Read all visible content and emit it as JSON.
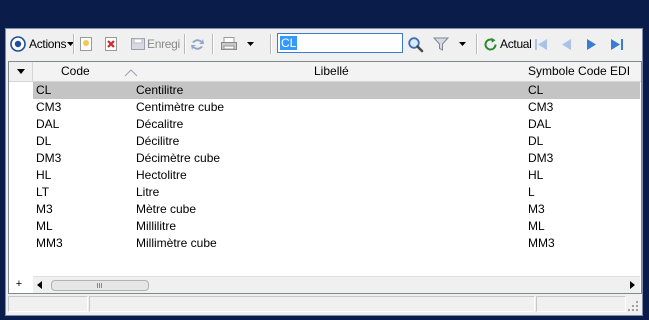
{
  "toolbar": {
    "actions_label": "Actions",
    "save_label": "Enregi",
    "search_value": "CL",
    "refresh_label": "Actual"
  },
  "grid": {
    "columns": [
      "Code",
      "Libellé",
      "Symbole Code EDI"
    ],
    "rows": [
      {
        "code": "CL",
        "libelle": "Centilitre",
        "edi": "CL"
      },
      {
        "code": "CM3",
        "libelle": "Centimètre cube",
        "edi": "CM3"
      },
      {
        "code": "DAL",
        "libelle": "Décalitre",
        "edi": "DAL"
      },
      {
        "code": "DL",
        "libelle": "Décilitre",
        "edi": "DL"
      },
      {
        "code": "DM3",
        "libelle": "Décimètre cube",
        "edi": "DM3"
      },
      {
        "code": "HL",
        "libelle": "Hectolitre",
        "edi": "HL"
      },
      {
        "code": "LT",
        "libelle": "Litre",
        "edi": "L"
      },
      {
        "code": "M3",
        "libelle": "Mètre cube",
        "edi": "M3"
      },
      {
        "code": "ML",
        "libelle": "Millilitre",
        "edi": "ML"
      },
      {
        "code": "MM3",
        "libelle": "Millimètre cube",
        "edi": "MM3"
      }
    ],
    "selected_index": 0,
    "add_row_symbol": "+"
  },
  "colors": {
    "background": "#0a1d4a",
    "selection": "#c4c4c4",
    "search_highlight": "#3399ff",
    "nav_arrow": "#3a7bd5"
  },
  "icons": [
    "actions-icon",
    "new-icon",
    "delete-icon",
    "save-icon",
    "refresh-icon",
    "print-icon",
    "search-icon",
    "filter-icon",
    "refresh-green-icon",
    "first-icon",
    "prev-icon",
    "next-icon",
    "last-icon"
  ]
}
